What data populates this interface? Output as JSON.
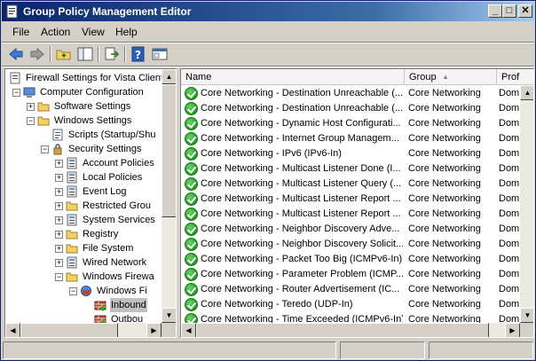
{
  "window": {
    "title": "Group Policy Management Editor"
  },
  "menu": {
    "file": "File",
    "action": "Action",
    "view": "View",
    "help": "Help"
  },
  "tree": [
    {
      "label": "Firewall Settings for Vista Client",
      "icon": "document-icon",
      "indent": 0,
      "expander": ""
    },
    {
      "label": "Computer Configuration",
      "icon": "computer-icon",
      "indent": 1,
      "expander": "−"
    },
    {
      "label": "Software Settings",
      "icon": "folder-icon",
      "indent": 2,
      "expander": "+"
    },
    {
      "label": "Windows Settings",
      "icon": "folder-icon",
      "indent": 2,
      "expander": "−"
    },
    {
      "label": "Scripts (Startup/Shu",
      "icon": "script-icon",
      "indent": 3,
      "expander": ""
    },
    {
      "label": "Security Settings",
      "icon": "security-icon",
      "indent": 3,
      "expander": "−"
    },
    {
      "label": "Account Policies",
      "icon": "policy-icon",
      "indent": 4,
      "expander": "+"
    },
    {
      "label": "Local Policies",
      "icon": "policy-icon",
      "indent": 4,
      "expander": "+"
    },
    {
      "label": "Event Log",
      "icon": "policy-icon",
      "indent": 4,
      "expander": "+"
    },
    {
      "label": "Restricted Grou",
      "icon": "folder-icon",
      "indent": 4,
      "expander": "+"
    },
    {
      "label": "System Services",
      "icon": "policy-icon",
      "indent": 4,
      "expander": "+"
    },
    {
      "label": "Registry",
      "icon": "folder-icon",
      "indent": 4,
      "expander": "+"
    },
    {
      "label": "File System",
      "icon": "folder-icon",
      "indent": 4,
      "expander": "+"
    },
    {
      "label": "Wired Network",
      "icon": "policy-icon",
      "indent": 4,
      "expander": "+"
    },
    {
      "label": "Windows Firewa",
      "icon": "folder-icon",
      "indent": 4,
      "expander": "−"
    },
    {
      "label": "Windows Fi",
      "icon": "firewall-icon",
      "indent": 5,
      "expander": "−"
    },
    {
      "label": "Inbound",
      "icon": "rules-icon",
      "indent": 6,
      "expander": "",
      "selected": true
    },
    {
      "label": "Outbou",
      "icon": "rules-icon",
      "indent": 6,
      "expander": ""
    }
  ],
  "columns": {
    "name": "Name",
    "group": "Group",
    "profile": "Prof"
  },
  "rules": [
    {
      "name": "Core Networking - Destination Unreachable (...",
      "group": "Core Networking",
      "profile": "Dom"
    },
    {
      "name": "Core Networking - Destination Unreachable (...",
      "group": "Core Networking",
      "profile": "Dom"
    },
    {
      "name": "Core Networking - Dynamic Host Configurati...",
      "group": "Core Networking",
      "profile": "Dom"
    },
    {
      "name": "Core Networking - Internet Group Managem...",
      "group": "Core Networking",
      "profile": "Dom"
    },
    {
      "name": "Core Networking - IPv6 (IPv6-In)",
      "group": "Core Networking",
      "profile": "Dom"
    },
    {
      "name": "Core Networking - Multicast Listener Done (I...",
      "group": "Core Networking",
      "profile": "Dom"
    },
    {
      "name": "Core Networking - Multicast Listener Query (...",
      "group": "Core Networking",
      "profile": "Dom"
    },
    {
      "name": "Core Networking - Multicast Listener Report ...",
      "group": "Core Networking",
      "profile": "Dom"
    },
    {
      "name": "Core Networking - Multicast Listener Report ...",
      "group": "Core Networking",
      "profile": "Dom"
    },
    {
      "name": "Core Networking - Neighbor Discovery Adve...",
      "group": "Core Networking",
      "profile": "Dom"
    },
    {
      "name": "Core Networking - Neighbor Discovery Solicit...",
      "group": "Core Networking",
      "profile": "Dom"
    },
    {
      "name": "Core Networking - Packet Too Big (ICMPv6-In)",
      "group": "Core Networking",
      "profile": "Dom"
    },
    {
      "name": "Core Networking - Parameter Problem (ICMP...",
      "group": "Core Networking",
      "profile": "Dom"
    },
    {
      "name": "Core Networking - Router Advertisement (IC...",
      "group": "Core Networking",
      "profile": "Dom"
    },
    {
      "name": "Core Networking - Teredo (UDP-In)",
      "group": "Core Networking",
      "profile": "Dom"
    },
    {
      "name": "Core Networking - Time Exceeded (ICMPv6-In)",
      "group": "Core Networking",
      "profile": "Dom"
    }
  ]
}
